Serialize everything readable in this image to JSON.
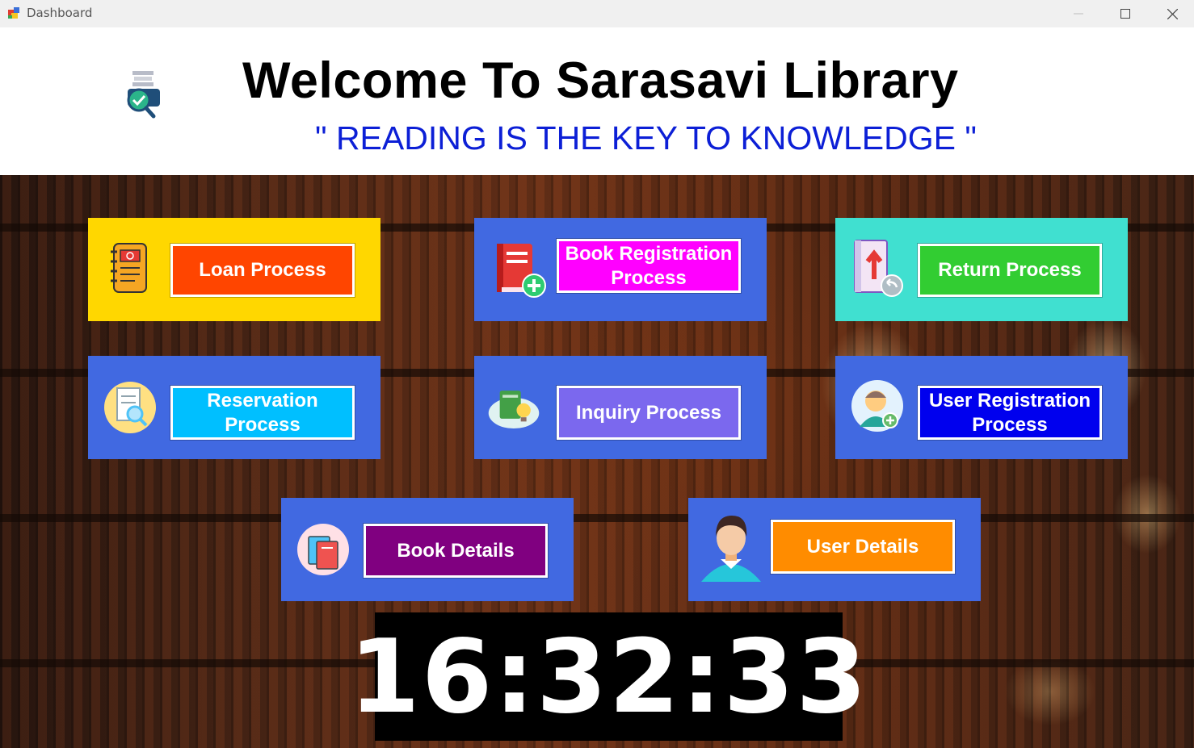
{
  "window": {
    "title": "Dashboard"
  },
  "header": {
    "welcome": "Welcome To Sarasavi Library",
    "slogan": "\" READING IS THE KEY TO KNOWLEDGE \""
  },
  "tiles": {
    "loan": {
      "label": "Loan Process",
      "icon": "notebook-icon",
      "tile_color": "#ffd700",
      "button_color": "#ff4500"
    },
    "book_registration": {
      "label": "Book Registration Process",
      "icon": "book-add-icon",
      "tile_color": "#4169e1",
      "button_color": "#ff00ff"
    },
    "return": {
      "label": "Return Process",
      "icon": "book-return-icon",
      "tile_color": "#40e0d0",
      "button_color": "#32cd32"
    },
    "reservation": {
      "label": "Reservation Process",
      "icon": "document-search-icon",
      "tile_color": "#4169e1",
      "button_color": "#00bfff"
    },
    "inquiry": {
      "label": "Inquiry Process",
      "icon": "book-idea-icon",
      "tile_color": "#4169e1",
      "button_color": "#7b68ee"
    },
    "user_registration": {
      "label": "User Registration Process",
      "icon": "user-add-icon",
      "tile_color": "#4169e1",
      "button_color": "#0000ee"
    },
    "book_details": {
      "label": "Book Details",
      "icon": "books-icon",
      "tile_color": "#4169e1",
      "button_color": "#800080"
    },
    "user_details": {
      "label": "User Details",
      "icon": "user-icon",
      "tile_color": "#4169e1",
      "button_color": "#ff8c00"
    }
  },
  "clock": {
    "time": "16:32:33"
  }
}
